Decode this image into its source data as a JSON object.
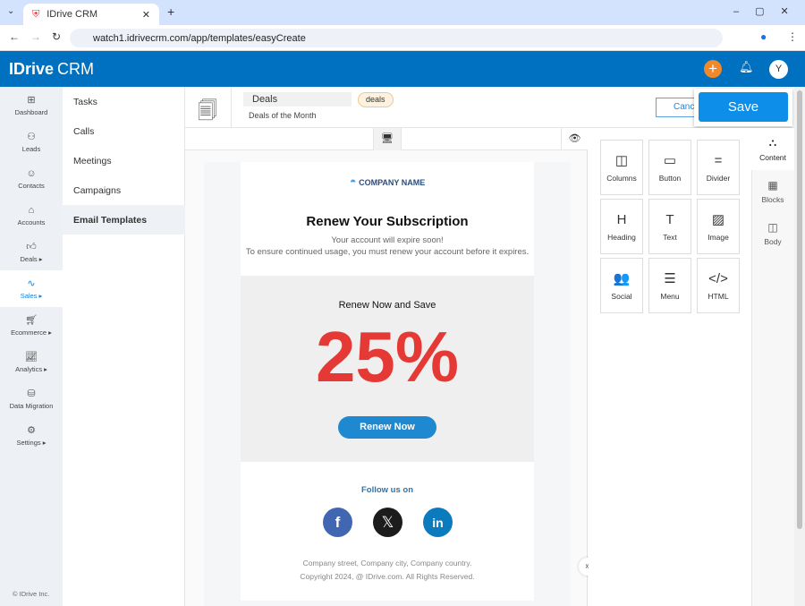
{
  "browser": {
    "tab_title": "IDrive CRM",
    "url": "watch1.idrivecrm.com/app/templates/easyCreate"
  },
  "header": {
    "logo": "IDrive CRM",
    "logo_main": "IDrive",
    "logo_suffix": "CRM",
    "avatar": "Y",
    "accent": "#0070c0"
  },
  "nav": [
    {
      "label": "Dashboard",
      "icon": "dashboard-icon"
    },
    {
      "label": "Leads",
      "icon": "leads-icon"
    },
    {
      "label": "Contacts",
      "icon": "contacts-icon"
    },
    {
      "label": "Accounts",
      "icon": "accounts-icon"
    },
    {
      "label": "Deals ▸",
      "icon": "deals-icon"
    },
    {
      "label": "Sales ▸",
      "icon": "sales-icon",
      "active": true
    },
    {
      "label": "Ecommerce ▸",
      "icon": "ecommerce-icon"
    },
    {
      "label": "Analytics ▸",
      "icon": "analytics-icon"
    },
    {
      "label": "Data Migration",
      "icon": "database-icon"
    },
    {
      "label": "Settings ▸",
      "icon": "gear-icon"
    }
  ],
  "footer": "© IDrive Inc.",
  "submenu": [
    "Tasks",
    "Calls",
    "Meetings",
    "Campaigns",
    "Email Templates"
  ],
  "template": {
    "name": "Deals",
    "badge": "deals",
    "subject": "Deals of the Month",
    "cancel": "Cancel",
    "save": "Save"
  },
  "email": {
    "company": "COMPANY NAME",
    "title": "Renew Your Subscription",
    "line1": "Your account will expire soon!",
    "line2": "To ensure continued usage, you must renew your account before it expires.",
    "promo_label": "Renew Now and Save",
    "discount": "25%",
    "cta": "Renew Now",
    "follow": "Follow us on",
    "address": "Company street, Company city, Company country.",
    "copyright": "Copyright 2024, @ IDrive.com. All Rights Reserved."
  },
  "blocks": [
    {
      "label": "Columns",
      "icon": "◫"
    },
    {
      "label": "Button",
      "icon": "▭"
    },
    {
      "label": "Divider",
      "icon": "="
    },
    {
      "label": "Heading",
      "icon": "H"
    },
    {
      "label": "Text",
      "icon": "T"
    },
    {
      "label": "Image",
      "icon": "▨"
    },
    {
      "label": "Social",
      "icon": "👥"
    },
    {
      "label": "Menu",
      "icon": "☰"
    },
    {
      "label": "HTML",
      "icon": "</>"
    }
  ],
  "right_tabs": [
    "Content",
    "Blocks",
    "Body"
  ]
}
